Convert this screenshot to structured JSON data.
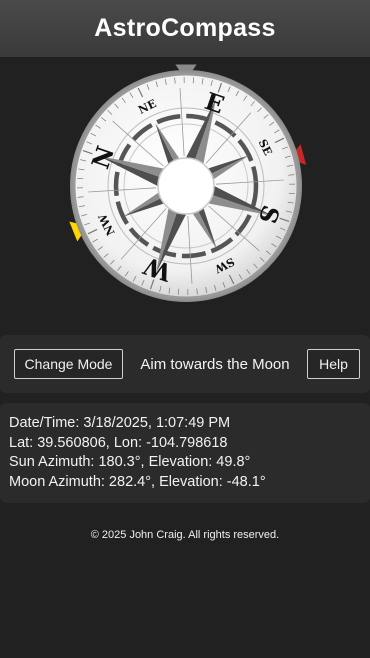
{
  "app": {
    "title": "AstroCompass"
  },
  "compass": {
    "labels": [
      "N",
      "NE",
      "E",
      "SE",
      "S",
      "SW",
      "W",
      "NW"
    ],
    "rotation_deg": -71,
    "markers": {
      "top_indicator_color": "#8a8a8a",
      "sun_marker_color": "#c62828",
      "moon_marker_color": "#ffd600"
    }
  },
  "controls": {
    "change_mode_label": "Change Mode",
    "aim_text": "Aim towards the Moon",
    "help_label": "Help"
  },
  "info": {
    "datetime": "Date/Time: 3/18/2025, 1:07:49 PM",
    "location": "Lat: 39.560806, Lon: -104.798618",
    "sun": "Sun Azimuth: 180.3°, Elevation: 49.8°",
    "moon": "Moon Azimuth: 282.4°, Elevation: -48.1°"
  },
  "footer": {
    "copyright": "© 2025 John Craig. All rights reserved."
  }
}
